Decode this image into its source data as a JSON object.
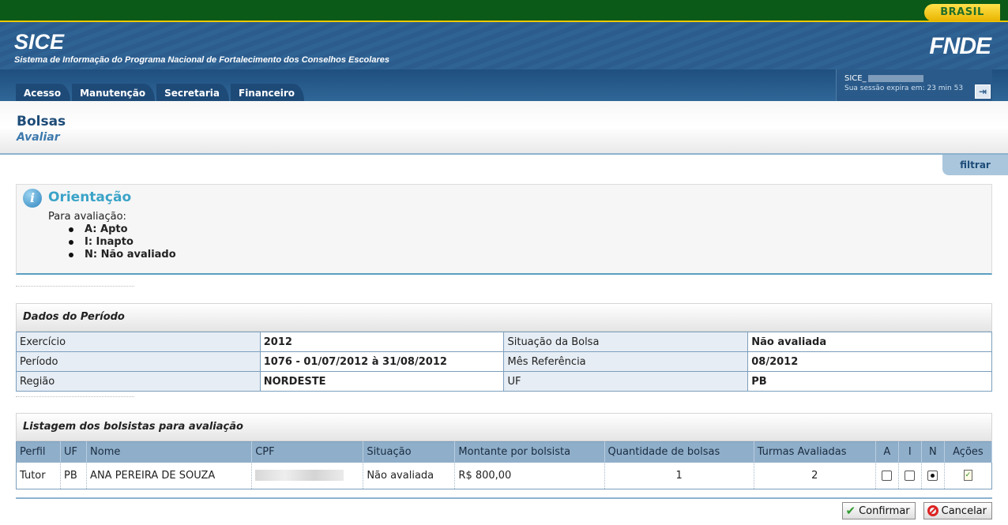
{
  "gov_bar": {
    "brand": "BRASIL"
  },
  "header": {
    "app_name": "SICE",
    "app_subtitle": "Sistema de Informação do Programa Nacional de Fortalecimento dos Conselhos Escolares",
    "logo": "FNDE",
    "nav": [
      "Acesso",
      "Manutenção",
      "Secretaria",
      "Financeiro"
    ],
    "session": {
      "user": "SICE_",
      "expire": "Sua sessão expira em: 23 min 53"
    }
  },
  "page": {
    "title": "Bolsas",
    "subtitle": "Avaliar",
    "filter_label": "filtrar"
  },
  "orientation": {
    "title": "Orientação",
    "intro": "Para avaliação:",
    "items": [
      "A: Apto",
      "I: Inapto",
      "N: Não avaliado"
    ]
  },
  "periodo": {
    "title": "Dados do Período",
    "rows": [
      {
        "l1": "Exercício",
        "v1": "2012",
        "l2": "Situação da Bolsa",
        "v2": "Não avaliada"
      },
      {
        "l1": "Período",
        "v1": "1076 - 01/07/2012 à 31/08/2012",
        "l2": "Mês Referência",
        "v2": "08/2012"
      },
      {
        "l1": "Região",
        "v1": "NORDESTE",
        "l2": "UF",
        "v2": "PB"
      }
    ]
  },
  "listagem": {
    "title": "Listagem dos bolsistas para avaliação",
    "columns": [
      "Perfil",
      "UF",
      "Nome",
      "CPF",
      "Situação",
      "Montante por bolsista",
      "Quantidade de bolsas",
      "Turmas Avaliadas",
      "A",
      "I",
      "N",
      "Ações"
    ],
    "rows": [
      {
        "perfil": "Tutor",
        "uf": "PB",
        "nome": "ANA PEREIRA DE SOUZA",
        "situacao": "Não avaliada",
        "montante": "R$ 800,00",
        "quantidade": "1",
        "turmas": "2",
        "selected": "N"
      }
    ]
  },
  "buttons": {
    "confirm": "Confirmar",
    "cancel": "Cancelar"
  }
}
